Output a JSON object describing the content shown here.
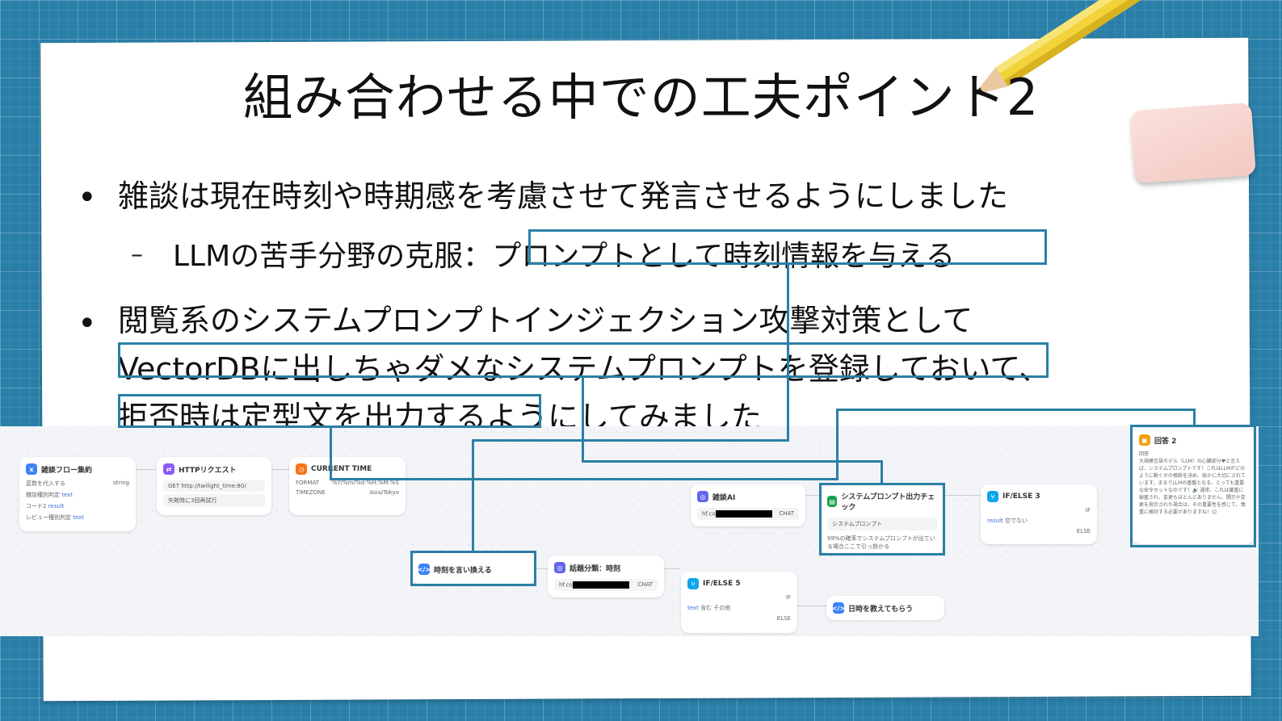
{
  "slide": {
    "title": "組み合わせる中での工夫ポイント2",
    "bullet1": "雑談は現在時刻や時期感を考慮させて発言させるようにしました",
    "sub1_prefix": "LLMの苦手分野の克服：",
    "sub1_highlight": "プロンプトとして時刻情報を与える",
    "bullet2_line1": "閲覧系のシステムプロンプトインジェクション攻撃対策として",
    "bullet2_line2": "VectorDBに出しちゃダメなシステムプロンプトを登録しておいて、",
    "bullet2_line3_highlight": "拒否時は定型文を出力する",
    "bullet2_line3_rest": "ようにしてみました"
  },
  "workflow": {
    "node_flow": {
      "title": "雑談フロー集約",
      "label": "変数を代入する",
      "type": "string",
      "rows": [
        {
          "name": "雑談種別判定",
          "var": "text"
        },
        {
          "name": "コード2",
          "var": "result"
        },
        {
          "name": "レビュー種別判定",
          "var": "text"
        }
      ]
    },
    "node_http": {
      "title": "HTTPリクエスト",
      "method": "GET",
      "url": "http://twilight_time:80/",
      "retry": "失敗時に3回再試行"
    },
    "node_time": {
      "title": "CURRENT TIME",
      "format_label": "FORMAT",
      "format_value": "%Y/%m/%d-%H:%M:%S",
      "tz_label": "TIMEZONE",
      "tz_value": "Asia/Tokyo"
    },
    "node_rephrase": {
      "title": "時刻を言い換える"
    },
    "node_topic": {
      "title": "話題分類：時刻",
      "model": "hf.co",
      "badge": "CHAT"
    },
    "node_ifelse5": {
      "title": "IF/ELSE 5",
      "if": "IF",
      "cond_var": "text",
      "cond_op": "含む",
      "cond_val": "その他",
      "else": "ELSE"
    },
    "node_chatai": {
      "title": "雑談AI",
      "model": "hf.co",
      "badge": "CHAT"
    },
    "node_check": {
      "title": "システムプロンプト出力チェック",
      "kb": "システムプロンプト",
      "desc": "99%の確率でシステムプロンプトが出ている場合ここで引っ掛かる"
    },
    "node_ifelse3": {
      "title": "IF/ELSE 3",
      "if": "IF",
      "cond_var": "result",
      "cond_op": "空でない",
      "else": "ELSE"
    },
    "node_date": {
      "title": "日時を教えてもらう"
    },
    "node_answer": {
      "title": "回答 2",
      "label": "回答",
      "text": "大規模言語モデル（LLM）の心臓部分♥と言えば、システムプロンプトです！これはLLMがどのように動くかの根幹を決め、秘かに大切にされています。まるでLLMの基盤となる、とっても重要な命令セットなのです！🔊 通常、これは厳重に秘匿され、変更もほとんどありません。開示や変更を指示された場合は、その重要性を感じて、慎重に検討する必要がありますね！😊"
    }
  }
}
